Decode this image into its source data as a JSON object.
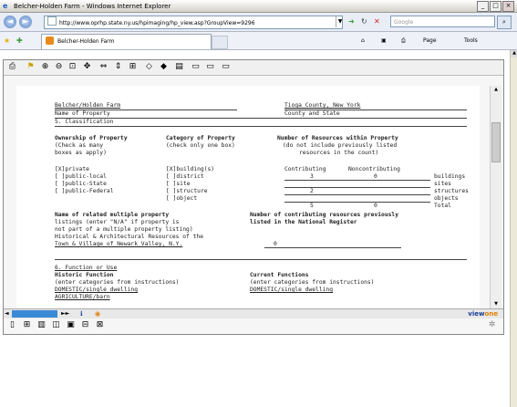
{
  "window": {
    "title": "Belcher-Holden Farm - Windows Internet Explorer",
    "min": "_",
    "max": "□",
    "close": "×"
  },
  "address_bar": {
    "url": "http://www.oprhp.state.ny.us/hpimaging/hp_view.asp?GroupView=9296",
    "search_placeholder": "Google",
    "back_icon": "back-arrow-icon",
    "forward_icon": "forward-arrow-icon"
  },
  "tabs": [
    {
      "label": "Belcher-Holden Farm"
    }
  ],
  "command_bar": {
    "home": "⌂",
    "feeds": "▣",
    "print": "⎙",
    "page": "Page",
    "tools": "Tools"
  },
  "viewer": {
    "brand_a": "view",
    "brand_b": "one"
  },
  "document": {
    "name_of_property_value": "Belcher/Holden Farm",
    "name_of_property_label": "Name of Property",
    "county_value": "Tioga County, New York",
    "county_label": "County and State",
    "section5": "5. Classification",
    "ownership_h1": "Ownership of Property",
    "ownership_h2": "(Check as many",
    "ownership_h3": "boxes as apply)",
    "category_h1": "Category of Property",
    "category_h2": "(check only one box)",
    "resources_h1": "Number of Resources within Property",
    "resources_h2": "(do not include previously listed",
    "resources_h3": "resources in the count)",
    "own_1": "[X]private",
    "own_2": "[ ]public-local",
    "own_3": "[ ]public-State",
    "own_4": "[ ]public-Federal",
    "cat_1": "[X]building(s)",
    "cat_2": "[ ]district",
    "cat_3": "[ ]site",
    "cat_4": "[ ]structure",
    "cat_5": "[ ]object",
    "col_contributing": "Contributing",
    "col_noncontributing": "Noncontributing",
    "r_buildings_c": "3",
    "r_buildings_n": "0",
    "r_buildings": "buildings",
    "r_sites": "sites",
    "r_structures_c": "2",
    "r_structures": "structures",
    "r_objects": "objects",
    "r_total_c": "5",
    "r_total_n": "0",
    "r_total": "Total",
    "related_h1": "Name of related multiple property",
    "related_h2": "listings (enter \"N/A\" if property is",
    "related_h3": "not part of a multiple property listing)",
    "related_h4": "Historical & Architectural Resources of the",
    "related_h5": "Town & Village of Newark Valley, N.Y.",
    "prev_h1": "Number of contributing resources previously",
    "prev_h2": "listed in the National Register",
    "prev_value": "0",
    "section6": "6. Function or Use",
    "hist_h1": "Historic Function",
    "hist_h2": "(enter categories from instructions)",
    "hist_v1": "DOMESTIC/single dwelling",
    "hist_v2": "AGRICULTURE/barn",
    "curr_h1": "Current Functions",
    "curr_h2": "(enter categories from instructions)",
    "curr_v1": "DOMESTIC/single dwelling"
  }
}
